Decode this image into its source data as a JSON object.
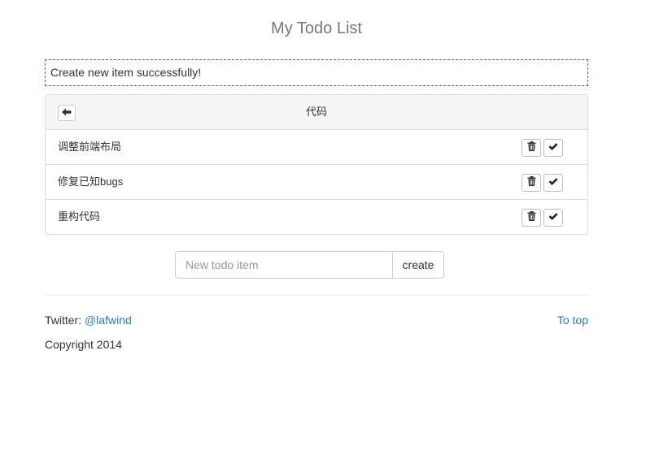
{
  "header": {
    "title": "My Todo List"
  },
  "flash": {
    "message": "Create new item successfully!"
  },
  "list": {
    "title": "代码",
    "items": [
      {
        "text": "调整前端布局"
      },
      {
        "text": "修复已知bugs"
      },
      {
        "text": "重构代码"
      }
    ]
  },
  "form": {
    "placeholder": "New todo item",
    "value": "",
    "button_label": "create"
  },
  "footer": {
    "twitter_label": "Twitter:",
    "twitter_handle": "@lafwind",
    "to_top": "To top",
    "copyright": "Copyright 2014"
  },
  "icons": {
    "back": "arrow-left-icon",
    "delete": "trash-icon",
    "done": "checkmark-icon"
  },
  "colors": {
    "link": "#337ab7",
    "flash_border": "#2e8b2e",
    "panel_heading_bg": "#f5f5f5"
  }
}
